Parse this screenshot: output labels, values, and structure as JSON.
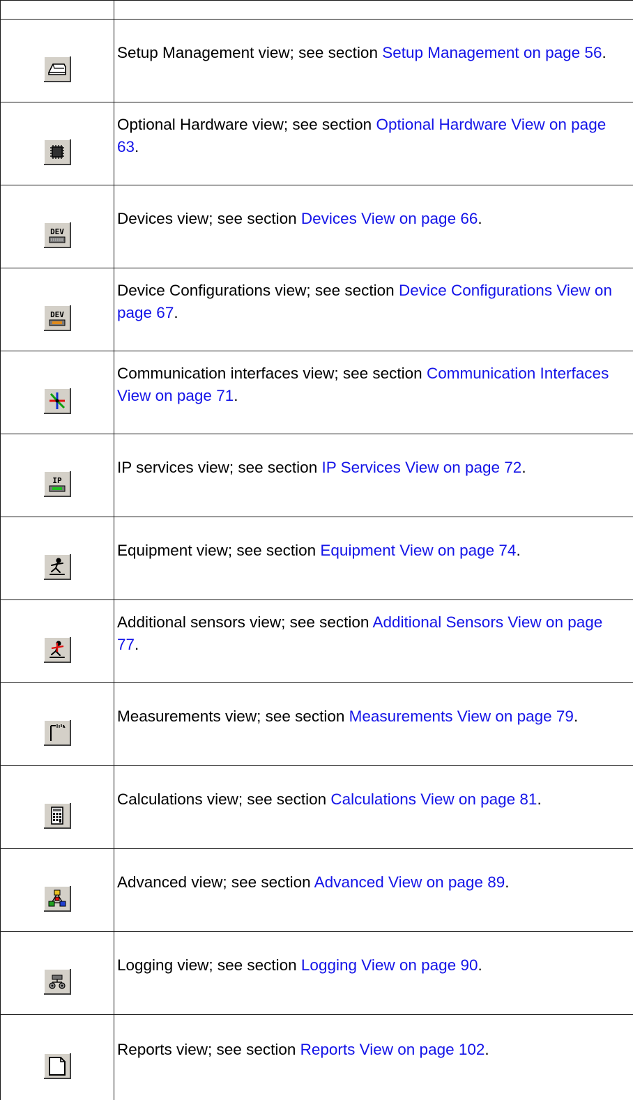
{
  "rows": [
    {
      "icon": "setup-management-icon",
      "text": "Setup Management view; see section ",
      "link": "Setup Management on page 56",
      "end": "."
    },
    {
      "icon": "optional-hardware-icon",
      "text": "Optional Hardware view; see section ",
      "link": "Optional Hardware View on page 63",
      "end": "."
    },
    {
      "icon": "devices-icon",
      "text": "Devices view; see section ",
      "link": "Devices View on page 66",
      "end": "."
    },
    {
      "icon": "device-configurations-icon",
      "text": "Device Configurations view; see section ",
      "link": "Device Configurations View on page 67",
      "end": "."
    },
    {
      "icon": "communication-interfaces-icon",
      "text": "Communication interfaces view; see section ",
      "link": "Communication Interfaces View on page 71",
      "end": "."
    },
    {
      "icon": "ip-services-icon",
      "text": "IP services view; see section ",
      "link": "IP Services View on page 72",
      "end": "."
    },
    {
      "icon": "equipment-icon",
      "text": "Equipment view; see section ",
      "link": "Equipment View on page 74",
      "end": "."
    },
    {
      "icon": "additional-sensors-icon",
      "text": "Additional sensors view; see section ",
      "link": "Additional Sensors View on page 77",
      "end": "."
    },
    {
      "icon": "measurements-icon",
      "text": "Measurements view; see section ",
      "link": "Measurements View on page 79",
      "end": "."
    },
    {
      "icon": "calculations-icon",
      "text": "Calculations view; see section ",
      "link": "Calculations View on page 81",
      "end": "."
    },
    {
      "icon": "advanced-icon",
      "text": "Advanced view; see section ",
      "link": "Advanced View on page 89",
      "end": "."
    },
    {
      "icon": "logging-icon",
      "text": "Logging view; see section ",
      "link": "Logging View on page 90",
      "end": "."
    },
    {
      "icon": "reports-icon",
      "text": "Reports view; see section ",
      "link": "Reports View on page 102",
      "end": "."
    }
  ],
  "icon_labels": {
    "dev_1": "DEV",
    "dev_2": "DEV",
    "ip": "IP"
  }
}
